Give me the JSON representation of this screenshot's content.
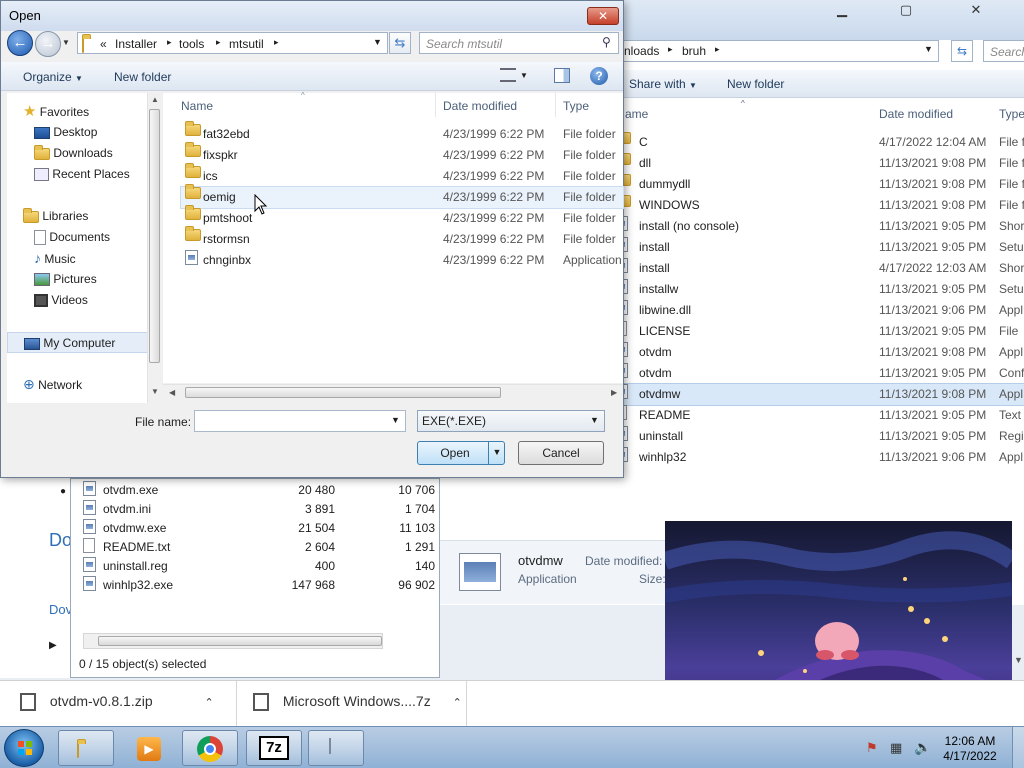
{
  "bg_explorer": {
    "address": [
      "nloads",
      "bruh"
    ],
    "search_placeholder": "Search",
    "toolbar": {
      "share_with": "Share with",
      "new_folder": "New folder"
    },
    "columns": {
      "name": "ame",
      "date_modified": "Date modified",
      "type": "Type"
    },
    "rows": [
      {
        "name": "C",
        "date": "4/17/2022 12:04 AM",
        "type": "File f",
        "icon": "folder"
      },
      {
        "name": "dll",
        "date": "11/13/2021 9:08 PM",
        "type": "File f",
        "icon": "folder"
      },
      {
        "name": "dummydll",
        "date": "11/13/2021 9:08 PM",
        "type": "File f",
        "icon": "folder"
      },
      {
        "name": "WINDOWS",
        "date": "11/13/2021 9:08 PM",
        "type": "File f",
        "icon": "folder"
      },
      {
        "name": "install (no console)",
        "date": "11/13/2021 9:05 PM",
        "type": "Short",
        "icon": "file"
      },
      {
        "name": "install",
        "date": "11/13/2021 9:05 PM",
        "type": "Setup",
        "icon": "file"
      },
      {
        "name": "install",
        "date": "4/17/2022 12:03 AM",
        "type": "Short",
        "icon": "file"
      },
      {
        "name": "installw",
        "date": "11/13/2021 9:05 PM",
        "type": "Setup",
        "icon": "file"
      },
      {
        "name": "libwine.dll",
        "date": "11/13/2021 9:06 PM",
        "type": "Appl",
        "icon": "file"
      },
      {
        "name": "LICENSE",
        "date": "11/13/2021 9:05 PM",
        "type": "File",
        "icon": "doc"
      },
      {
        "name": "otvdm",
        "date": "11/13/2021 9:08 PM",
        "type": "Appl",
        "icon": "file"
      },
      {
        "name": "otvdm",
        "date": "11/13/2021 9:05 PM",
        "type": "Conf",
        "icon": "file"
      },
      {
        "name": "otvdmw",
        "date": "11/13/2021 9:08 PM",
        "type": "Appl",
        "icon": "file",
        "selected": true
      },
      {
        "name": "README",
        "date": "11/13/2021 9:05 PM",
        "type": "Text",
        "icon": "doc"
      },
      {
        "name": "uninstall",
        "date": "11/13/2021 9:05 PM",
        "type": "Regis",
        "icon": "file"
      },
      {
        "name": "winhlp32",
        "date": "11/13/2021 9:06 PM",
        "type": "Appl",
        "icon": "file"
      }
    ],
    "details": {
      "name": "otvdmw",
      "kind": "Application",
      "date_label": "Date modified:",
      "size_label": "Size:"
    }
  },
  "archive": {
    "rows": [
      {
        "name": "otvdm.exe",
        "size": "20 480",
        "packed": "10 706"
      },
      {
        "name": "otvdm.ini",
        "size": "3 891",
        "packed": "1 704"
      },
      {
        "name": "otvdmw.exe",
        "size": "21 504",
        "packed": "11 103"
      },
      {
        "name": "README.txt",
        "size": "2 604",
        "packed": "1 291"
      },
      {
        "name": "uninstall.reg",
        "size": "400",
        "packed": "140"
      },
      {
        "name": "winhlp32.exe",
        "size": "147 968",
        "packed": "96 902"
      }
    ],
    "status": "0 / 15 object(s) selected",
    "side_text_1": "Do",
    "side_text_2": "Dov"
  },
  "dialog": {
    "title": "Open",
    "close": "✕",
    "address": [
      "«",
      "Installer",
      "tools",
      "mtsutil"
    ],
    "search_placeholder": "Search mtsutil",
    "toolbar": {
      "organize": "Organize",
      "new_folder": "New folder"
    },
    "nav": {
      "favorites": "Favorites",
      "desktop": "Desktop",
      "downloads": "Downloads",
      "recent": "Recent Places",
      "libraries": "Libraries",
      "documents": "Documents",
      "music": "Music",
      "pictures": "Pictures",
      "videos": "Videos",
      "computer": "My Computer",
      "network": "Network"
    },
    "columns": {
      "name": "Name",
      "date_modified": "Date modified",
      "type": "Type"
    },
    "files": [
      {
        "name": "fat32ebd",
        "date": "4/23/1999 6:22 PM",
        "type": "File folder",
        "icon": "folder"
      },
      {
        "name": "fixspkr",
        "date": "4/23/1999 6:22 PM",
        "type": "File folder",
        "icon": "folder"
      },
      {
        "name": "ics",
        "date": "4/23/1999 6:22 PM",
        "type": "File folder",
        "icon": "folder"
      },
      {
        "name": "oemig",
        "date": "4/23/1999 6:22 PM",
        "type": "File folder",
        "icon": "folder",
        "hover": true
      },
      {
        "name": "pmtshoot",
        "date": "4/23/1999 6:22 PM",
        "type": "File folder",
        "icon": "folder"
      },
      {
        "name": "rstormsn",
        "date": "4/23/1999 6:22 PM",
        "type": "File folder",
        "icon": "folder"
      },
      {
        "name": "chnginbx",
        "date": "4/23/1999 6:22 PM",
        "type": "Application",
        "icon": "app"
      }
    ],
    "file_name_label": "File name:",
    "file_name_value": "",
    "file_type": "EXE(*.EXE)",
    "open_label": "Open",
    "cancel_label": "Cancel"
  },
  "downloads": [
    {
      "name": "otvdm-v0.8.1.zip"
    },
    {
      "name": "Microsoft Windows....7z"
    }
  ],
  "taskbar": {
    "time": "12:06 AM",
    "date": "4/17/2022"
  }
}
